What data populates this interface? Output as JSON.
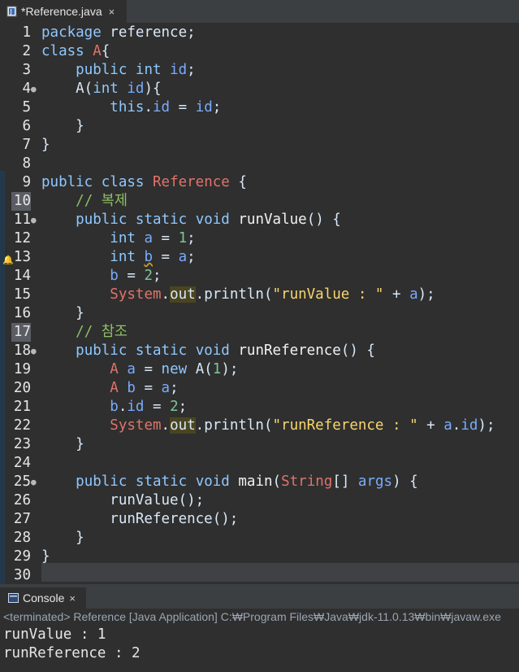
{
  "editor_tab": {
    "title": "*Reference.java",
    "close": "×"
  },
  "code": [
    {
      "n": "1",
      "tokens": [
        [
          "kw",
          "package"
        ],
        [
          "tx",
          " reference;"
        ]
      ]
    },
    {
      "n": "2",
      "tokens": [
        [
          "kw",
          "class"
        ],
        [
          "tx",
          " "
        ],
        [
          "ty",
          "A"
        ],
        [
          "tx",
          "{"
        ]
      ]
    },
    {
      "n": "3",
      "tokens": [
        [
          "tx",
          "    "
        ],
        [
          "kw",
          "public"
        ],
        [
          "tx",
          " "
        ],
        [
          "kw",
          "int"
        ],
        [
          "tx",
          " "
        ],
        [
          "va",
          "id"
        ],
        [
          "tx",
          ";"
        ]
      ]
    },
    {
      "n": "4",
      "fold": true,
      "tokens": [
        [
          "tx",
          "    A("
        ],
        [
          "kw",
          "int"
        ],
        [
          "tx",
          " "
        ],
        [
          "va",
          "id"
        ],
        [
          "tx",
          "){"
        ]
      ]
    },
    {
      "n": "5",
      "tokens": [
        [
          "tx",
          "        "
        ],
        [
          "kw",
          "this"
        ],
        [
          "tx",
          "."
        ],
        [
          "va",
          "id"
        ],
        [
          "tx",
          " = "
        ],
        [
          "va",
          "id"
        ],
        [
          "tx",
          ";"
        ]
      ]
    },
    {
      "n": "6",
      "tokens": [
        [
          "tx",
          "    }"
        ]
      ]
    },
    {
      "n": "7",
      "tokens": [
        [
          "tx",
          "}"
        ]
      ]
    },
    {
      "n": "8",
      "tokens": []
    },
    {
      "n": "9",
      "tokens": [
        [
          "kw",
          "public"
        ],
        [
          "tx",
          " "
        ],
        [
          "kw",
          "class"
        ],
        [
          "tx",
          " "
        ],
        [
          "ty",
          "Reference"
        ],
        [
          "tx",
          " {"
        ]
      ]
    },
    {
      "n": "10",
      "hl": true,
      "tokens": [
        [
          "tx",
          "    "
        ],
        [
          "cm",
          "// 복제"
        ]
      ]
    },
    {
      "n": "11",
      "fold": true,
      "tokens": [
        [
          "tx",
          "    "
        ],
        [
          "kw",
          "public"
        ],
        [
          "tx",
          " "
        ],
        [
          "kw",
          "static"
        ],
        [
          "tx",
          " "
        ],
        [
          "kw",
          "void"
        ],
        [
          "tx",
          " "
        ],
        [
          "fn",
          "runValue"
        ],
        [
          "tx",
          "() {"
        ]
      ]
    },
    {
      "n": "12",
      "tokens": [
        [
          "tx",
          "        "
        ],
        [
          "kw",
          "int"
        ],
        [
          "tx",
          " "
        ],
        [
          "va",
          "a"
        ],
        [
          "tx",
          " = "
        ],
        [
          "nu",
          "1"
        ],
        [
          "tx",
          ";"
        ]
      ]
    },
    {
      "n": "13",
      "marker": true,
      "tokens": [
        [
          "tx",
          "        "
        ],
        [
          "kw",
          "int"
        ],
        [
          "tx",
          " "
        ],
        [
          "sq",
          "b"
        ],
        [
          "tx",
          " = "
        ],
        [
          "va",
          "a"
        ],
        [
          "tx",
          ";"
        ]
      ]
    },
    {
      "n": "14",
      "tokens": [
        [
          "tx",
          "        "
        ],
        [
          "va",
          "b"
        ],
        [
          "tx",
          " = "
        ],
        [
          "nu",
          "2"
        ],
        [
          "tx",
          ";"
        ]
      ]
    },
    {
      "n": "15",
      "tokens": [
        [
          "tx",
          "        "
        ],
        [
          "ty",
          "System"
        ],
        [
          "tx",
          "."
        ],
        [
          "oc",
          "out"
        ],
        [
          "tx",
          ".println("
        ],
        [
          "st",
          "\"runValue : \""
        ],
        [
          "tx",
          " + "
        ],
        [
          "va",
          "a"
        ],
        [
          "tx",
          ");"
        ]
      ]
    },
    {
      "n": "16",
      "tokens": [
        [
          "tx",
          "    }"
        ]
      ]
    },
    {
      "n": "17",
      "hl": true,
      "tokens": [
        [
          "tx",
          "    "
        ],
        [
          "cm",
          "// 참조"
        ]
      ]
    },
    {
      "n": "18",
      "fold": true,
      "tokens": [
        [
          "tx",
          "    "
        ],
        [
          "kw",
          "public"
        ],
        [
          "tx",
          " "
        ],
        [
          "kw",
          "static"
        ],
        [
          "tx",
          " "
        ],
        [
          "kw",
          "void"
        ],
        [
          "tx",
          " "
        ],
        [
          "fn",
          "runReference"
        ],
        [
          "tx",
          "() {"
        ]
      ]
    },
    {
      "n": "19",
      "tokens": [
        [
          "tx",
          "        "
        ],
        [
          "ty",
          "A"
        ],
        [
          "tx",
          " "
        ],
        [
          "va",
          "a"
        ],
        [
          "tx",
          " = "
        ],
        [
          "kw",
          "new"
        ],
        [
          "tx",
          " A("
        ],
        [
          "nu",
          "1"
        ],
        [
          "tx",
          ");"
        ]
      ]
    },
    {
      "n": "20",
      "tokens": [
        [
          "tx",
          "        "
        ],
        [
          "ty",
          "A"
        ],
        [
          "tx",
          " "
        ],
        [
          "va",
          "b"
        ],
        [
          "tx",
          " = "
        ],
        [
          "va",
          "a"
        ],
        [
          "tx",
          ";"
        ]
      ]
    },
    {
      "n": "21",
      "tokens": [
        [
          "tx",
          "        "
        ],
        [
          "va",
          "b"
        ],
        [
          "tx",
          "."
        ],
        [
          "va",
          "id"
        ],
        [
          "tx",
          " = "
        ],
        [
          "nu",
          "2"
        ],
        [
          "tx",
          ";"
        ]
      ]
    },
    {
      "n": "22",
      "tokens": [
        [
          "tx",
          "        "
        ],
        [
          "ty",
          "System"
        ],
        [
          "tx",
          "."
        ],
        [
          "oc",
          "out"
        ],
        [
          "tx",
          ".println("
        ],
        [
          "st",
          "\"runReference : \""
        ],
        [
          "tx",
          " + "
        ],
        [
          "va",
          "a"
        ],
        [
          "tx",
          "."
        ],
        [
          "va",
          "id"
        ],
        [
          "tx",
          ");"
        ]
      ]
    },
    {
      "n": "23",
      "tokens": [
        [
          "tx",
          "    }"
        ]
      ]
    },
    {
      "n": "24",
      "tokens": []
    },
    {
      "n": "25",
      "fold": true,
      "tokens": [
        [
          "tx",
          "    "
        ],
        [
          "kw",
          "public"
        ],
        [
          "tx",
          " "
        ],
        [
          "kw",
          "static"
        ],
        [
          "tx",
          " "
        ],
        [
          "kw",
          "void"
        ],
        [
          "tx",
          " "
        ],
        [
          "fn",
          "main"
        ],
        [
          "tx",
          "("
        ],
        [
          "ty",
          "String"
        ],
        [
          "tx",
          "[] "
        ],
        [
          "va",
          "args"
        ],
        [
          "tx",
          ") {"
        ]
      ]
    },
    {
      "n": "26",
      "tokens": [
        [
          "tx",
          "        runValue();"
        ]
      ]
    },
    {
      "n": "27",
      "tokens": [
        [
          "tx",
          "        runReference();"
        ]
      ]
    },
    {
      "n": "28",
      "tokens": [
        [
          "tx",
          "    }"
        ]
      ]
    },
    {
      "n": "29",
      "tokens": [
        [
          "tx",
          "}"
        ]
      ]
    },
    {
      "n": "30",
      "tokens": []
    }
  ],
  "console": {
    "tab_title": "Console",
    "close": "×",
    "status": "<terminated> Reference [Java Application] C:₩Program Files₩Java₩jdk-11.0.13₩bin₩javaw.exe",
    "output": [
      "runValue : 1",
      "runReference : 2"
    ]
  },
  "colors": {
    "background": "#2f2f2f",
    "keyword": "#8fc8ff",
    "type": "#e0736a",
    "string": "#f8d66d",
    "comment": "#8fbf64"
  },
  "icons": {
    "editor_tab": "java-file-icon",
    "console_tab": "console-icon",
    "line13": "warning-bulb-icon"
  }
}
